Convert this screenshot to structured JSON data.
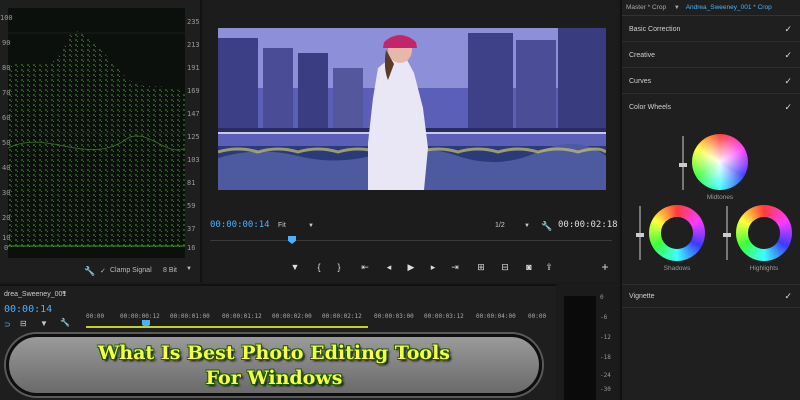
{
  "scope": {
    "left_ticks": [
      "100",
      "90",
      "80",
      "70",
      "60",
      "50",
      "40",
      "30",
      "20",
      "10",
      "0"
    ],
    "right_ticks": [
      "235",
      "213",
      "191",
      "169",
      "147",
      "125",
      "103",
      "81",
      "59",
      "37",
      "16"
    ],
    "clamp_label": "Clamp Signal",
    "bit_depth": "8 Bit"
  },
  "program": {
    "timecode_current": "00:00:00:14",
    "fit_label": "Fit",
    "resolution": "1/2",
    "timecode_duration": "00:00:02:18"
  },
  "lumetri": {
    "master_label": "Master * Crop",
    "clip_label": "Andrea_Sweeney_001 * Crop",
    "sections": [
      {
        "label": "Basic Correction",
        "checked": "✓"
      },
      {
        "label": "Creative",
        "checked": "✓"
      },
      {
        "label": "Curves",
        "checked": "✓"
      },
      {
        "label": "Color Wheels",
        "checked": "✓"
      },
      {
        "label": "Vignette",
        "checked": "✓"
      }
    ],
    "wheels": {
      "midtones": "Midtones",
      "shadows": "Shadows",
      "highlights": "Highlights"
    }
  },
  "timeline": {
    "sequence_name": "drea_Sweeney_001",
    "timecode": "00:00:14",
    "ruler": [
      "00:00",
      "00:00:00:12",
      "00:00:01:00",
      "00:00:01:12",
      "00:00:02:00",
      "00:00:02:12",
      "00:00:03:00",
      "00:00:03:12",
      "00:00:04:00",
      "00:00"
    ]
  },
  "meter": {
    "ticks": [
      "0",
      "-6",
      "-12",
      "-18",
      "-24",
      "-30"
    ]
  },
  "banner": {
    "line1": "What Is Best Photo Editing Tools",
    "line2": "For Windows"
  }
}
